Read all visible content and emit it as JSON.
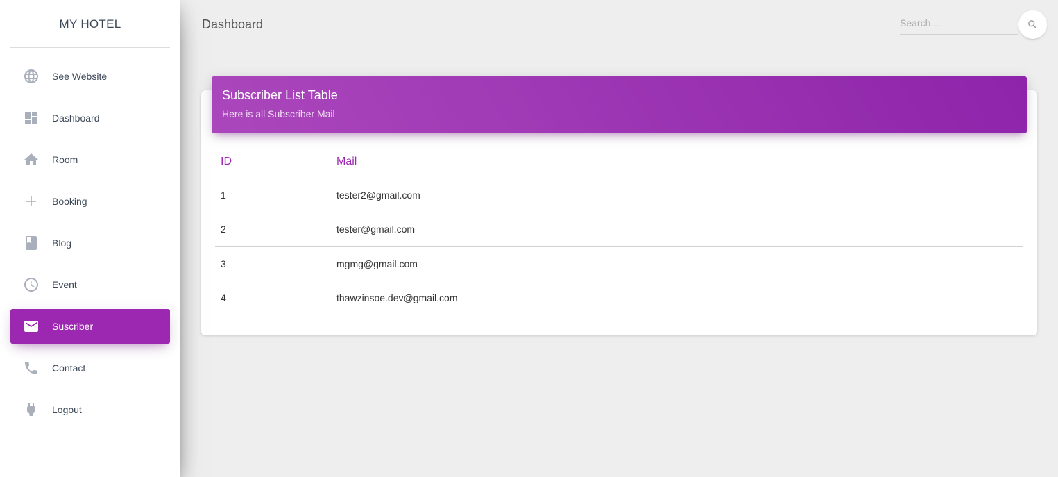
{
  "sidebar": {
    "logo": "MY HOTEL",
    "items": [
      {
        "label": "See Website",
        "icon": "globe-icon"
      },
      {
        "label": "Dashboard",
        "icon": "dashboard-icon"
      },
      {
        "label": "Room",
        "icon": "home-icon"
      },
      {
        "label": "Booking",
        "icon": "plus-icon"
      },
      {
        "label": "Blog",
        "icon": "book-icon"
      },
      {
        "label": "Event",
        "icon": "clock-icon"
      },
      {
        "label": "Suscriber",
        "icon": "mail-icon",
        "active": true
      },
      {
        "label": "Contact",
        "icon": "phone-icon"
      },
      {
        "label": "Logout",
        "icon": "plug-icon"
      }
    ]
  },
  "topbar": {
    "title": "Dashboard",
    "search_placeholder": "Search...",
    "search_icon": "search-icon"
  },
  "card": {
    "title": "Subscriber List Table",
    "subtitle": "Here is all Subscriber Mail",
    "table": {
      "headers": [
        "ID",
        "Mail"
      ],
      "rows": [
        [
          "1",
          "tester2@gmail.com"
        ],
        [
          "2",
          "tester@gmail.com"
        ],
        [
          "3",
          "mgmg@gmail.com"
        ],
        [
          "4",
          "thawzinsoe.dev@gmail.com"
        ]
      ]
    }
  },
  "colors": {
    "accent": "#9c27b0",
    "header_gradient_start": "#ab47bc",
    "header_gradient_end": "#8e24aa",
    "background": "#eeeeee",
    "icon_gray": "#a9afbb"
  }
}
